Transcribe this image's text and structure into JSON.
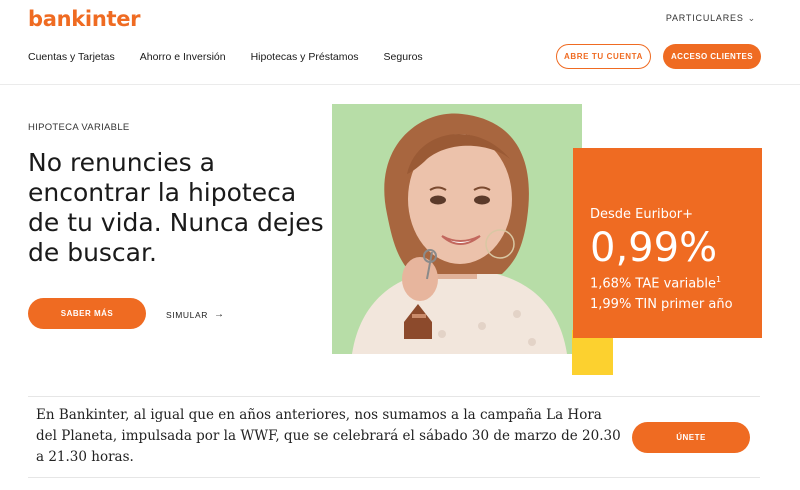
{
  "brand": {
    "logo_text": "bankinter",
    "color": "#ef6b22"
  },
  "header": {
    "segment_label": "PARTICULARES",
    "nav": [
      {
        "label": "Cuentas y Tarjetas"
      },
      {
        "label": "Ahorro e Inversión"
      },
      {
        "label": "Hipotecas y Préstamos"
      },
      {
        "label": "Seguros"
      }
    ],
    "open_account_label": "ABRE TU CUENTA",
    "client_access_label": "ACCESO CLIENTES"
  },
  "hero": {
    "kicker": "HIPOTECA VARIABLE",
    "headline": "No renuncies a encontrar la hipoteca de tu vida. Nunca dejes de buscar.",
    "cta_label": "SABER MÁS",
    "simulate_label": "SIMULAR",
    "photo_bg": "#b7dda7",
    "accent_yellow": "#fcd12f"
  },
  "promo": {
    "line1": "Desde Euribor+",
    "rate": "0,99%",
    "tae": "1,68% TAE variable",
    "tae_note": "1",
    "tin": "1,99% TIN primer año"
  },
  "notice": {
    "text": "En Bankinter, al igual que en años anteriores, nos sumamos a la campaña La Hora del Planeta, impulsada por la WWF, que se celebrará el sábado 30 de marzo de 20.30 a 21.30 horas.",
    "join_label": "ÚNETE"
  },
  "icons": {
    "segment_dropdown": "chevron-down-icon",
    "simulate_arrow": "arrow-right-icon"
  }
}
